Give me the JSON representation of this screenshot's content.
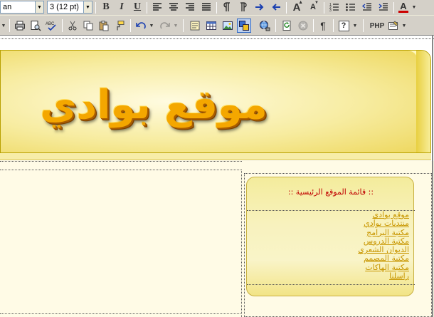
{
  "toolbar1": {
    "font_name_value": "an",
    "font_size_value": "3 (12 pt)",
    "bold_label": "B",
    "italic_label": "I",
    "underline_label": "U",
    "font_grow_label": "A",
    "font_shrink_label": "A",
    "font_color_label": "A",
    "colors": {
      "font_color_bar": "#cc0000"
    }
  },
  "toolbar2": {
    "paragraph_label": "¶",
    "help_label": "?",
    "php_label": "PHP"
  },
  "page": {
    "logo_text": "موقع بوادي",
    "menu_title": ":: قائمة الموقع الرئيسية ::",
    "menu_items": [
      "موقع بوادي",
      "منتديات بوادي",
      "مكتبة البرامج",
      "مكتبة الدروس",
      "الديوان الشعري",
      "مكتبة المصمم",
      "مكتبة الهاكات",
      "راسلنا"
    ],
    "colors": {
      "menu_title": "#c00000",
      "menu_link": "#c89600",
      "banner_gold": "#f4a700"
    }
  }
}
